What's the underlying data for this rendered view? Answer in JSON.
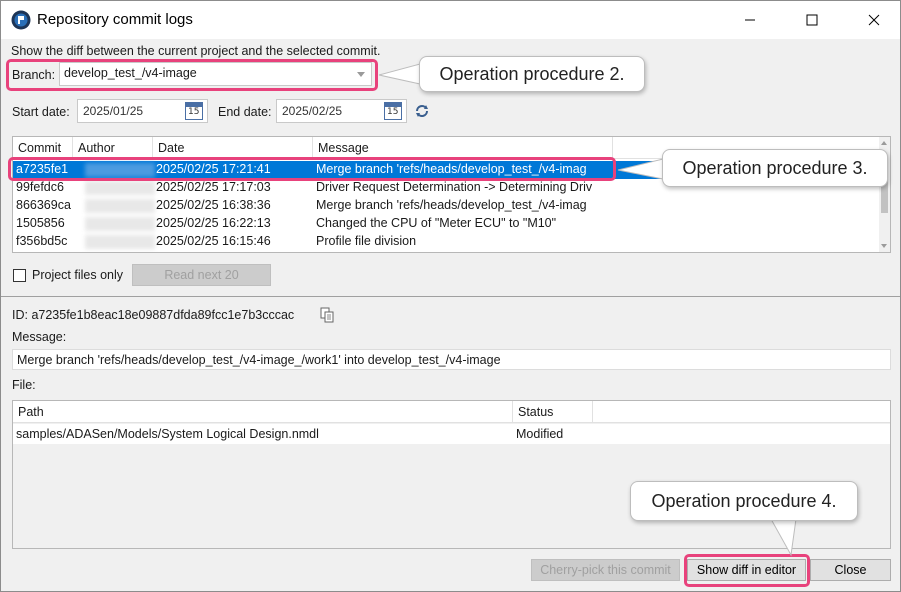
{
  "window": {
    "title": "Repository commit logs"
  },
  "description": "Show the diff between the current project and the selected commit.",
  "branch": {
    "label": "Branch:",
    "value": "develop_test_/v4-image"
  },
  "dates": {
    "start_label": "Start date:",
    "start_value": "2025/01/25",
    "end_label": "End date:",
    "end_value": "2025/02/25",
    "calendar_day": "15"
  },
  "commits": {
    "headers": [
      "Commit",
      "Author",
      "Date",
      "Message"
    ],
    "rows": [
      {
        "commit": "a7235fe1",
        "date": "2025/02/25 17:21:41",
        "message": "Merge branch 'refs/heads/develop_test_/v4-imag"
      },
      {
        "commit": "99fefdc6",
        "date": "2025/02/25 17:17:03",
        "message": "Driver Request Determination -> Determining Driv"
      },
      {
        "commit": "866369ca",
        "date": "2025/02/25 16:38:36",
        "message": "Merge branch 'refs/heads/develop_test_/v4-imag"
      },
      {
        "commit": "1505856",
        "date": "2025/02/25 16:22:13",
        "message": "Changed the CPU of \"Meter ECU\" to \"M10\""
      },
      {
        "commit": "f356bd5c",
        "date": "2025/02/25 16:15:46",
        "message": "Profile file division"
      }
    ]
  },
  "filter": {
    "project_files_only_label": "Project files only",
    "read_next_label": "Read next 20"
  },
  "details": {
    "id_text": "ID: a7235fe1b8eac18e09887dfda89fcc1e7b3cccac",
    "message_label": "Message:",
    "message_value": "Merge branch 'refs/heads/develop_test_/v4-image_/work1' into develop_test_/v4-image",
    "file_label": "File:"
  },
  "files": {
    "headers": [
      "Path",
      "Status"
    ],
    "rows": [
      {
        "path": "samples/ADASen/Models/System Logical Design.nmdl",
        "status": "Modified"
      }
    ]
  },
  "buttons": {
    "cherry_pick": "Cherry-pick this commit",
    "show_diff": "Show diff in editor",
    "close": "Close"
  },
  "annotations": {
    "step2": "Operation procedure 2.",
    "step3": "Operation procedure 3.",
    "step4": "Operation procedure 4."
  },
  "colors": {
    "highlight": "#e8427c",
    "selection": "#0078d7"
  }
}
